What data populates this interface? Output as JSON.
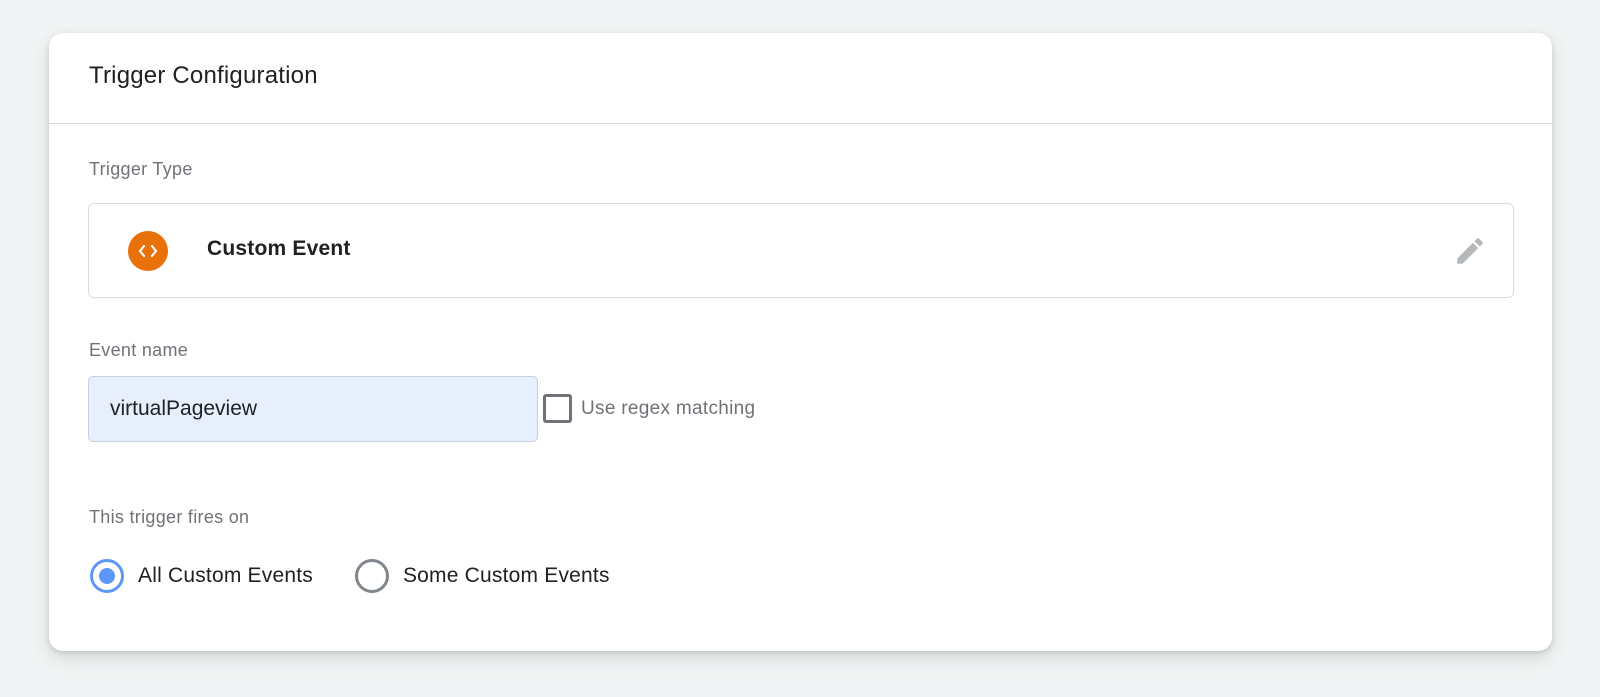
{
  "header": {
    "title": "Trigger Configuration"
  },
  "trigger_type": {
    "label": "Trigger Type",
    "name": "Custom Event",
    "icon": "code-brackets-icon",
    "icon_color": "#e8710a",
    "edit_icon": "pencil-icon"
  },
  "event_name": {
    "label": "Event name",
    "value": "virtualPageview",
    "regex_label": "Use regex matching",
    "regex_checked": false
  },
  "fires_on": {
    "label": "This trigger fires on",
    "options": [
      {
        "label": "All Custom Events",
        "selected": true
      },
      {
        "label": "Some Custom Events",
        "selected": false
      }
    ],
    "accent_color": "#5e97f6"
  }
}
